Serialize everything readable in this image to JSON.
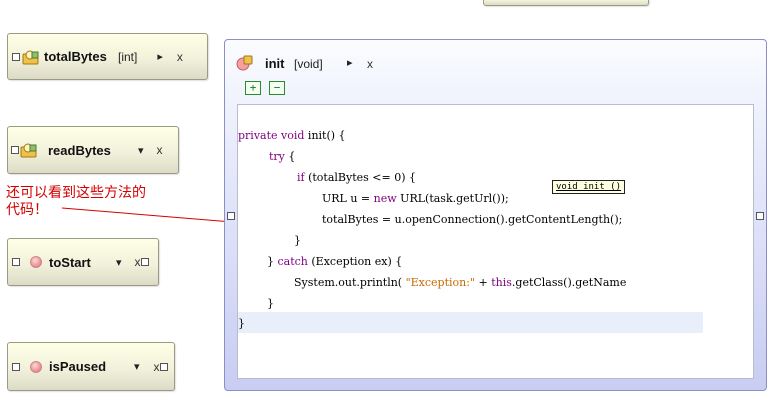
{
  "nodes": [
    {
      "name": "totalBytes",
      "type": "[int]",
      "arrow": "▸",
      "close": "x"
    },
    {
      "name": "readBytes",
      "arrow": "▾",
      "close": "x"
    },
    {
      "name": "toStart",
      "arrow": "▾",
      "close": "x"
    },
    {
      "name": "isPaused",
      "arrow": "▾",
      "close": "x"
    }
  ],
  "annotation": {
    "line1": "还可以看到这些方法的",
    "line2": "代码！"
  },
  "method": {
    "name": "init",
    "type": "[void]",
    "arrow": "▸",
    "close": "x",
    "plus": "+",
    "minus": "−",
    "tooltip": "void init ()",
    "code": {
      "l1_kw1": "private",
      "l1_kw2": "void",
      "l1_rest": " init() {",
      "l2_kw": "try",
      "l2_rest": " {",
      "l3_kw": "if",
      "l3_rest": " (totalBytes <= 0) {",
      "l4_a": "URL u = ",
      "l4_kw": "new",
      "l4_b": " URL(task.getUrl());",
      "l5": "totalBytes = u.openConnection().getContentLength();",
      "l6": "}",
      "l7_a": "} ",
      "l7_kw": "catch",
      "l7_b": " (Exception ex) {",
      "l8_a": "System.out.println( ",
      "l8_str": "\"Exception:\"",
      "l8_b": " + ",
      "l8_kw": "this",
      "l8_c": ".getClass().getName",
      "l9": "}",
      "l10": "}"
    }
  },
  "colors": {
    "annotation": "#d40000",
    "keyword": "#7f007f",
    "string": "#c66a00"
  }
}
